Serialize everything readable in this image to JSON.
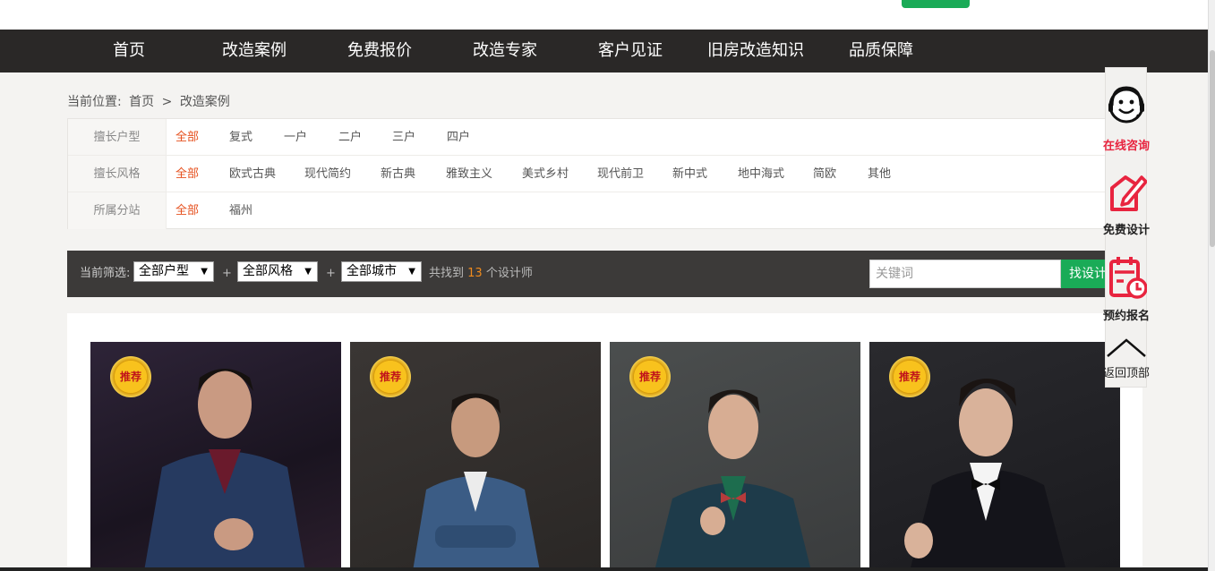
{
  "nav": {
    "items": [
      "首页",
      "改造案例",
      "免费报价",
      "改造专家",
      "客户见证",
      "旧房改造知识",
      "品质保障"
    ]
  },
  "breadcrumb": {
    "prefix": "当前位置:",
    "home": "首页",
    "sep": ">",
    "current": "改造案例"
  },
  "filters": {
    "house_type": {
      "label": "擅长户型",
      "options": [
        "全部",
        "复式",
        "一户",
        "二户",
        "三户",
        "四户"
      ]
    },
    "style": {
      "label": "擅长风格",
      "options": [
        "全部",
        "欧式古典",
        "现代简约",
        "新古典",
        "雅致主义",
        "美式乡村",
        "现代前卫",
        "新中式",
        "地中海式",
        "简欧",
        "其他"
      ]
    },
    "branch": {
      "label": "所属分站",
      "options": [
        "全部",
        "福州"
      ]
    }
  },
  "filterbar": {
    "label": "当前筛选:",
    "select_house": "全部户型",
    "select_style": "全部风格",
    "select_city": "全部城市",
    "plus": "+",
    "found_prefix": "共找到",
    "found_count": "13",
    "found_suffix": "个设计师",
    "keyword_placeholder": "关键词",
    "search_button": "找设计"
  },
  "cards": {
    "badge": "推荐",
    "count": 4
  },
  "sidebar": {
    "consult": "在线咨询",
    "free_design": "免费设计",
    "appointment": "预约报名",
    "back_top": "返回顶部"
  },
  "colors": {
    "nav_bg": "#2a2827",
    "accent_orange": "#e6501e",
    "green": "#1aab57",
    "sidebar_red": "#e8243f"
  }
}
